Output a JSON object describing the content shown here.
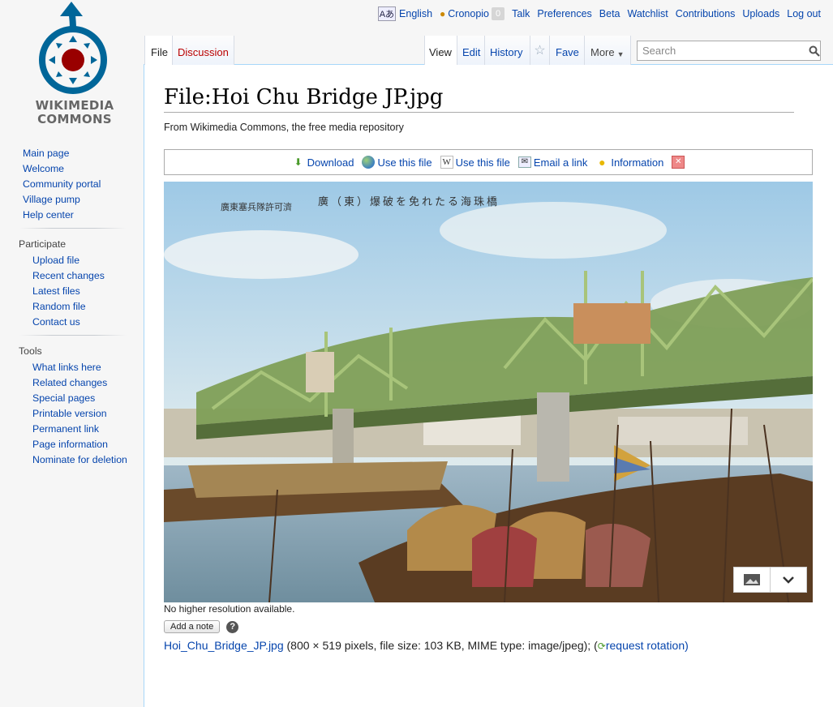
{
  "personal_tools": {
    "language": "English",
    "username": "Cronopio",
    "notifications": "0",
    "links": [
      "Talk",
      "Preferences",
      "Beta",
      "Watchlist",
      "Contributions",
      "Uploads",
      "Log out"
    ]
  },
  "logo": {
    "line1": "WIKIMEDIA",
    "line2": "COMMONS"
  },
  "sidebar": {
    "navigation": [
      "Main page",
      "Welcome",
      "Community portal",
      "Village pump",
      "Help center"
    ],
    "participate": {
      "heading": "Participate",
      "items": [
        "Upload file",
        "Recent changes",
        "Latest files",
        "Random file",
        "Contact us"
      ]
    },
    "tools": {
      "heading": "Tools",
      "items": [
        "What links here",
        "Related changes",
        "Special pages",
        "Printable version",
        "Permanent link",
        "Page information",
        "Nominate for deletion"
      ]
    }
  },
  "tabs": {
    "left": [
      "File",
      "Discussion"
    ],
    "right": [
      "View",
      "Edit",
      "History",
      "Fave",
      "More"
    ]
  },
  "search": {
    "placeholder": "Search"
  },
  "page": {
    "title": "File:Hoi Chu Bridge JP.jpg",
    "subtitle": "From Wikimedia Commons, the free media repository",
    "toolbar": [
      "Download",
      "Use this file",
      "Use this file",
      "Email a link",
      "Information"
    ],
    "image_caption_text": "廣東塞兵隊許可濟",
    "image_title_text": "廣（東）爆破を免れたる海珠橋",
    "no_higher": "No higher resolution available.",
    "add_note": "Add a note",
    "help": "?",
    "file_name": "Hoi_Chu_Bridge_JP.jpg",
    "file_details": " (800 × 519 pixels, file size: 103 KB, MIME type: image/jpeg); (",
    "request_rotation": "request rotation",
    "close_paren": ")"
  },
  "colors": {
    "link": "#0645ad",
    "border": "#a7d7f9",
    "sidebar_bg": "#f6f6f6"
  }
}
